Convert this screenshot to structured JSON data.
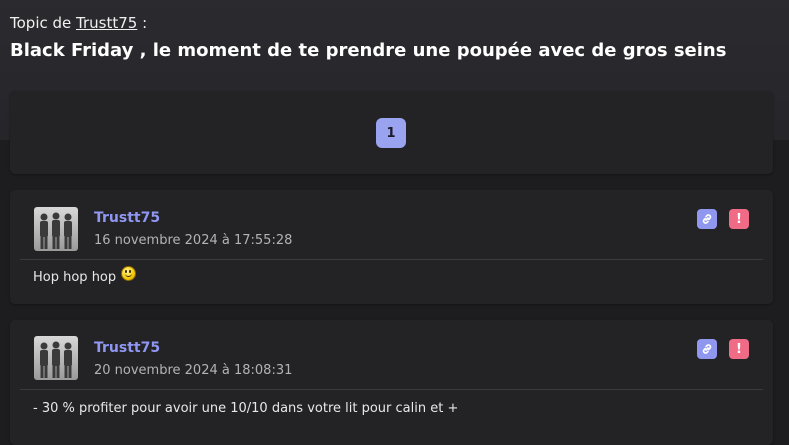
{
  "topic": {
    "prefix": "Topic de ",
    "author_link": "Trustt75",
    "suffix": " :",
    "title": "Black Friday , le moment de te prendre une poupée avec de gros seins"
  },
  "pagination": {
    "current_page": "1"
  },
  "posts": [
    {
      "author": "Trustt75",
      "date": "16 novembre 2024 à 17:55:28",
      "body": "Hop hop hop",
      "emoji": "smiley"
    },
    {
      "author": "Trustt75",
      "date": "20 novembre 2024 à 18:08:31",
      "body": "- 30 % profiter pour avoir une 10/10 dans votre lit pour calin et +"
    }
  ],
  "icons": {
    "permalink": "link-icon",
    "report": "alert-icon"
  },
  "colors": {
    "author": "#8f97f2",
    "page_button": "#9aa3f0",
    "link_button": "#8f97ef",
    "report_button": "#f06b85",
    "background": "#1d1d20",
    "card": "#232326"
  }
}
